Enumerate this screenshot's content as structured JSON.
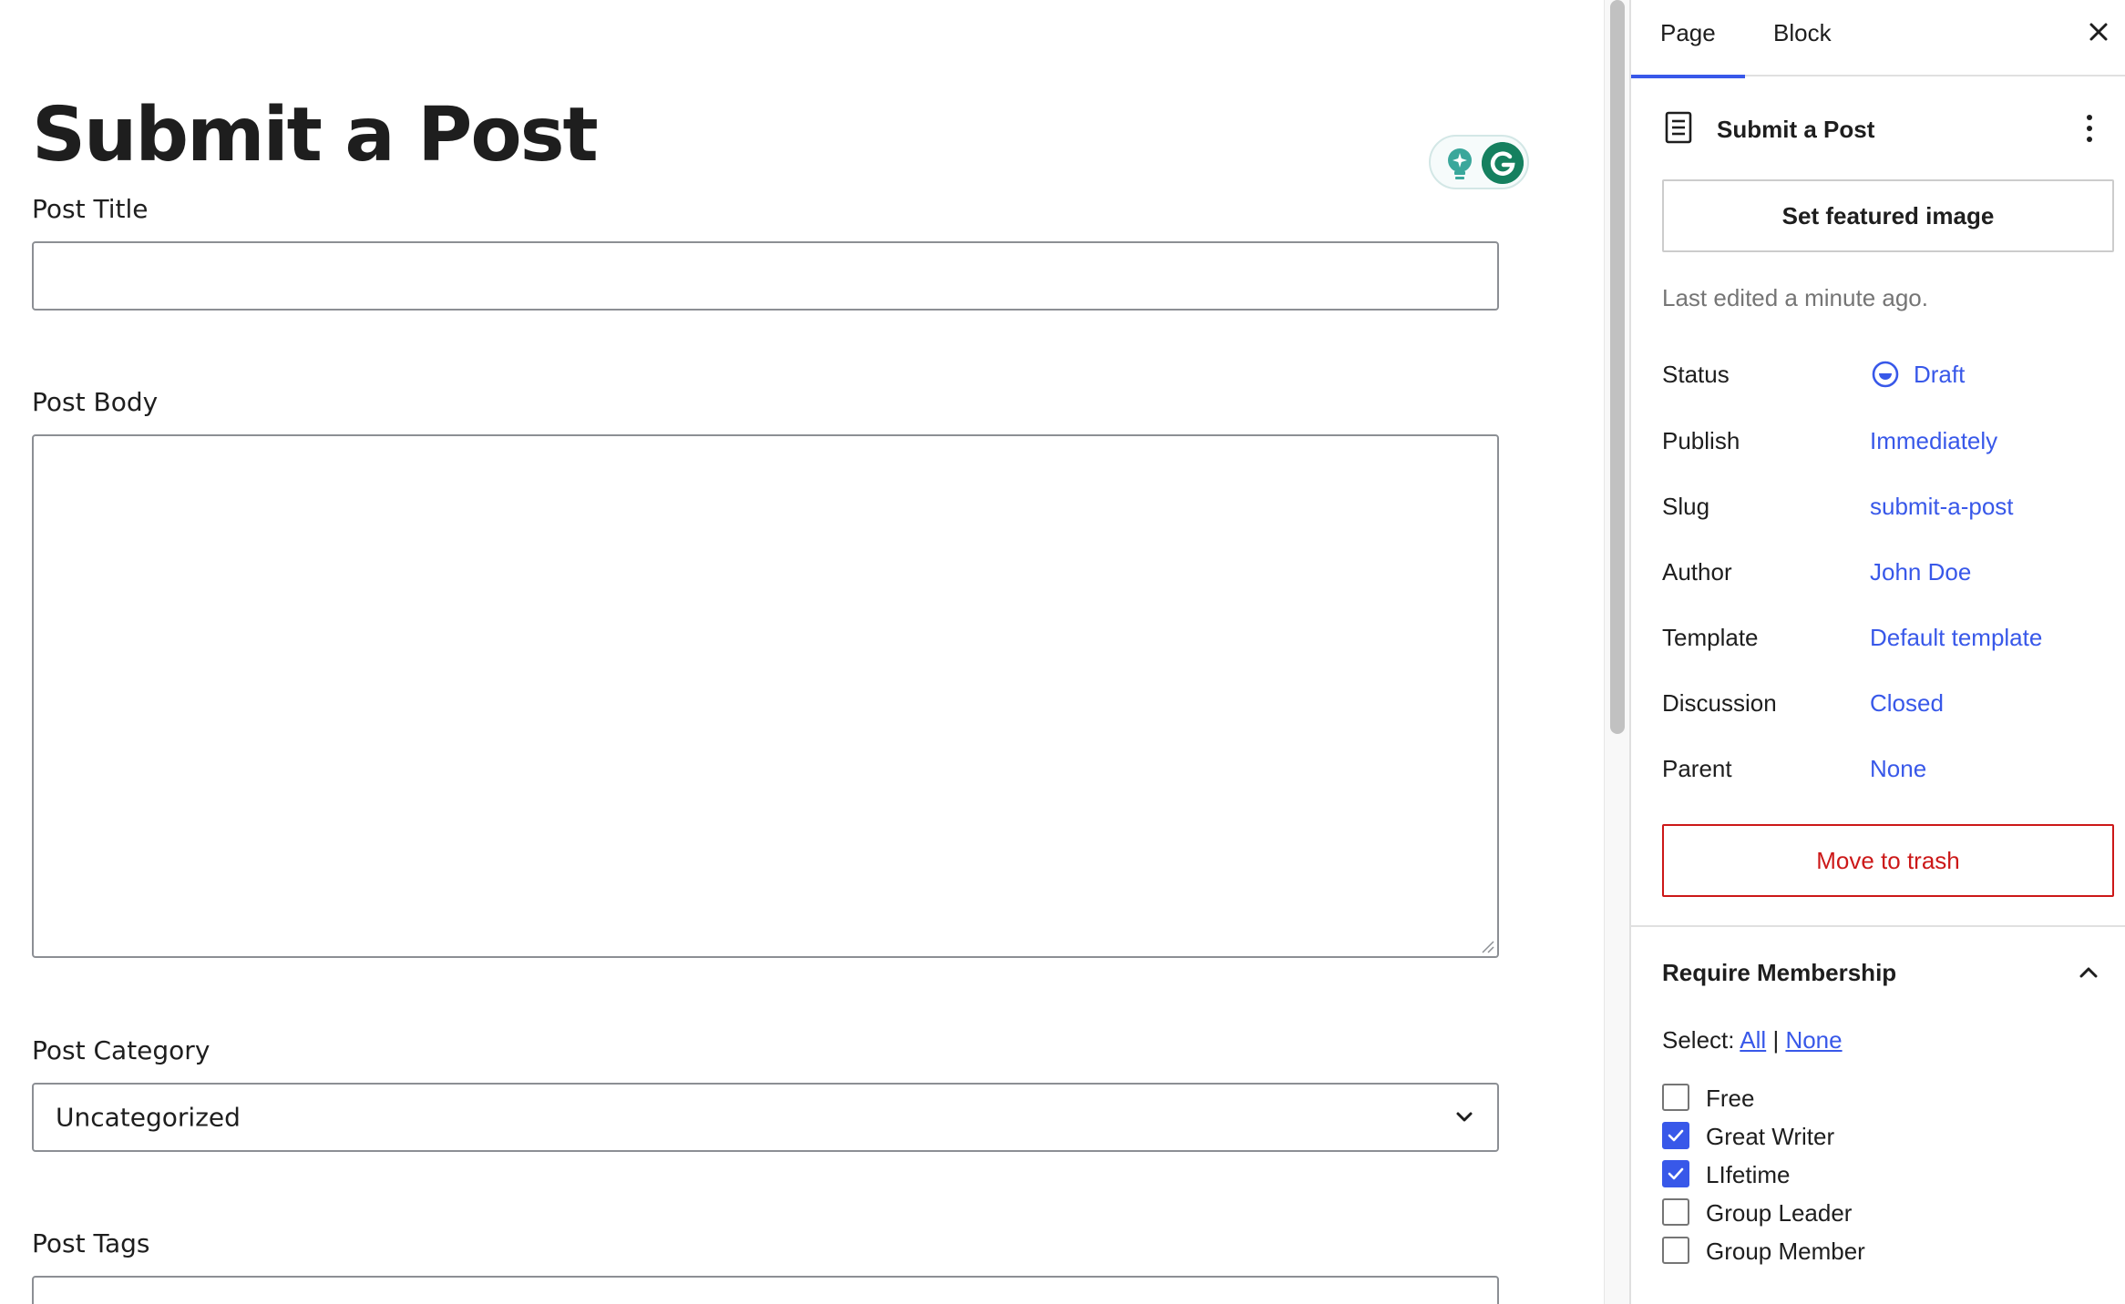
{
  "editor": {
    "page_title": "Submit a Post",
    "fields": {
      "post_title_label": "Post Title",
      "post_title_value": "",
      "post_body_label": "Post Body",
      "post_body_value": "",
      "post_category_label": "Post Category",
      "post_category_value": "Uncategorized",
      "post_tags_label": "Post Tags",
      "post_tags_value": ""
    }
  },
  "sidebar": {
    "tabs": [
      {
        "label": "Page",
        "active": true
      },
      {
        "label": "Block",
        "active": false
      }
    ],
    "document": {
      "title": "Submit a Post",
      "featured_image_button": "Set featured image",
      "last_edited": "Last edited a minute ago."
    },
    "meta": {
      "status": {
        "label": "Status",
        "value": "Draft"
      },
      "publish": {
        "label": "Publish",
        "value": "Immediately"
      },
      "slug": {
        "label": "Slug",
        "value": "submit-a-post"
      },
      "author": {
        "label": "Author",
        "value": "John Doe"
      },
      "template": {
        "label": "Template",
        "value": "Default template"
      },
      "discussion": {
        "label": "Discussion",
        "value": "Closed"
      },
      "parent": {
        "label": "Parent",
        "value": "None"
      }
    },
    "trash_button": "Move to trash",
    "membership": {
      "title": "Require Membership",
      "select_prefix": "Select:",
      "select_all": "All",
      "select_separator": "|",
      "select_none": "None",
      "levels": [
        {
          "label": "Free",
          "checked": false
        },
        {
          "label": "Great Writer",
          "checked": true
        },
        {
          "label": "LIfetime",
          "checked": true
        },
        {
          "label": "Group Leader",
          "checked": false
        },
        {
          "label": "Group Member",
          "checked": false
        }
      ]
    }
  },
  "colors": {
    "accent": "#3858e9",
    "danger": "#cc1818",
    "muted": "#757575",
    "grammarly": "#15805f"
  }
}
